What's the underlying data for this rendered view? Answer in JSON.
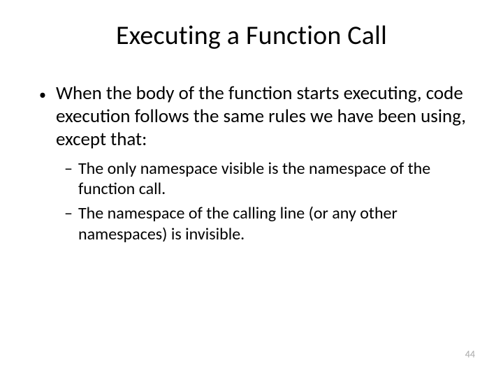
{
  "slide": {
    "title": "Executing a Function Call",
    "bullets": [
      {
        "text": "When the body of the function starts executing, code execution follows the same rules we have been using, except that:",
        "subs": [
          {
            "text": "The only namespace visible is the namespace of the function call."
          },
          {
            "text": "The namespace of the calling line (or any other namespaces) is invisible."
          }
        ]
      }
    ],
    "pageNumber": "44"
  }
}
